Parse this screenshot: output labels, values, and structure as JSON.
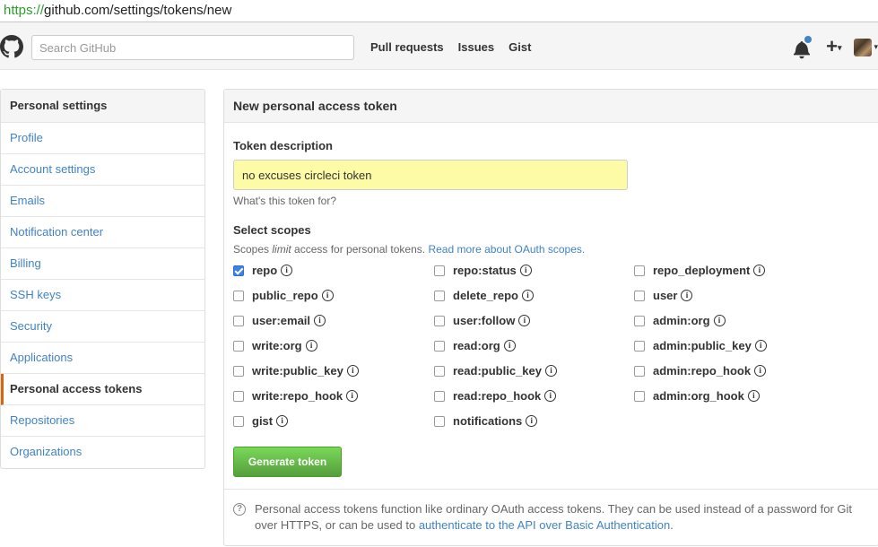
{
  "browser": {
    "url_scheme": "https://",
    "url_rest": "github.com/settings/tokens/new"
  },
  "header": {
    "search_placeholder": "Search GitHub",
    "nav": [
      "Pull requests",
      "Issues",
      "Gist"
    ],
    "plus_label": "+",
    "caret": "▾"
  },
  "sidebar": {
    "heading": "Personal settings",
    "items": [
      {
        "label": "Profile"
      },
      {
        "label": "Account settings"
      },
      {
        "label": "Emails"
      },
      {
        "label": "Notification center"
      },
      {
        "label": "Billing"
      },
      {
        "label": "SSH keys"
      },
      {
        "label": "Security"
      },
      {
        "label": "Applications"
      },
      {
        "label": "Personal access tokens"
      },
      {
        "label": "Repositories"
      },
      {
        "label": "Organizations"
      }
    ],
    "selected": "Personal access tokens"
  },
  "main": {
    "title": "New personal access token",
    "token_description_label": "Token description",
    "token_description_value": "no excuses circleci token",
    "token_hint": "What's this token for?",
    "scopes_label": "Select scopes",
    "scopes_note_pre": "Scopes ",
    "scopes_note_em": "limit",
    "scopes_note_post": " access for personal tokens. ",
    "scopes_note_link": "Read more about OAuth scopes.",
    "info_glyph": "i",
    "scopes": [
      [
        {
          "name": "repo",
          "checked": true
        },
        {
          "name": "repo:status",
          "checked": false
        },
        {
          "name": "repo_deployment",
          "checked": false
        }
      ],
      [
        {
          "name": "public_repo",
          "checked": false
        },
        {
          "name": "delete_repo",
          "checked": false
        },
        {
          "name": "user",
          "checked": false
        }
      ],
      [
        {
          "name": "user:email",
          "checked": false
        },
        {
          "name": "user:follow",
          "checked": false
        },
        {
          "name": "admin:org",
          "checked": false
        }
      ],
      [
        {
          "name": "write:org",
          "checked": false
        },
        {
          "name": "read:org",
          "checked": false
        },
        {
          "name": "admin:public_key",
          "checked": false
        }
      ],
      [
        {
          "name": "write:public_key",
          "checked": false
        },
        {
          "name": "read:public_key",
          "checked": false
        },
        {
          "name": "admin:repo_hook",
          "checked": false
        }
      ],
      [
        {
          "name": "write:repo_hook",
          "checked": false
        },
        {
          "name": "read:repo_hook",
          "checked": false
        },
        {
          "name": "admin:org_hook",
          "checked": false
        }
      ],
      [
        {
          "name": "gist",
          "checked": false
        },
        {
          "name": "notifications",
          "checked": false
        }
      ]
    ],
    "generate_button": "Generate token",
    "help_glyph": "?",
    "help_text": "Personal access tokens function like ordinary OAuth access tokens. They can be used instead of a password for Git over HTTPS, or can be used to ",
    "help_link": "authenticate to the API over Basic Authentication",
    "help_end": "."
  },
  "colors": {
    "link": "#4183c4",
    "selected_accent": "#d26911",
    "token_input_bg": "#fdfba6",
    "button_green": "#6cc644",
    "notification_dot": "#4183c4"
  }
}
